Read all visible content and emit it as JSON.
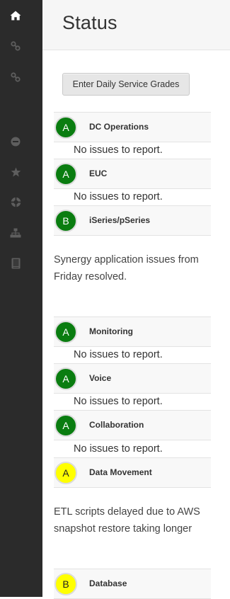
{
  "page": {
    "title": "Status"
  },
  "sidebar": {
    "items": [
      {
        "icon": "home-icon"
      },
      {
        "icon": "link-icon"
      },
      {
        "icon": "link-icon"
      },
      {
        "icon": "minus-circle-icon"
      },
      {
        "icon": "star-icon"
      },
      {
        "icon": "lifebuoy-icon"
      },
      {
        "icon": "sitemap-icon"
      },
      {
        "icon": "book-icon"
      }
    ]
  },
  "actions": {
    "enter_grades_label": "Enter Daily Service Grades"
  },
  "services": [
    {
      "grade": "A",
      "color": "#0a7d10",
      "name": "DC Operations",
      "note": "No issues to report."
    },
    {
      "grade": "A",
      "color": "#0a7d10",
      "name": "EUC",
      "note": "No issues to report."
    },
    {
      "grade": "B",
      "color": "#0a7d10",
      "name": "iSeries/pSeries",
      "note": "Synergy application issues from Friday resolved."
    },
    {
      "grade": "A",
      "color": "#0a7d10",
      "name": "Monitoring",
      "note": "No issues to report."
    },
    {
      "grade": "A",
      "color": "#0a7d10",
      "name": "Voice",
      "note": "No issues to report."
    },
    {
      "grade": "A",
      "color": "#0a7d10",
      "name": "Collaboration",
      "note": "No issues to report."
    },
    {
      "grade": "A",
      "color": "#ffff00",
      "name": "Data Movement",
      "note": "ETL scripts delayed due to AWS snapshot restore taking longer"
    },
    {
      "grade": "B",
      "color": "#ffff00",
      "name": "Database"
    }
  ]
}
